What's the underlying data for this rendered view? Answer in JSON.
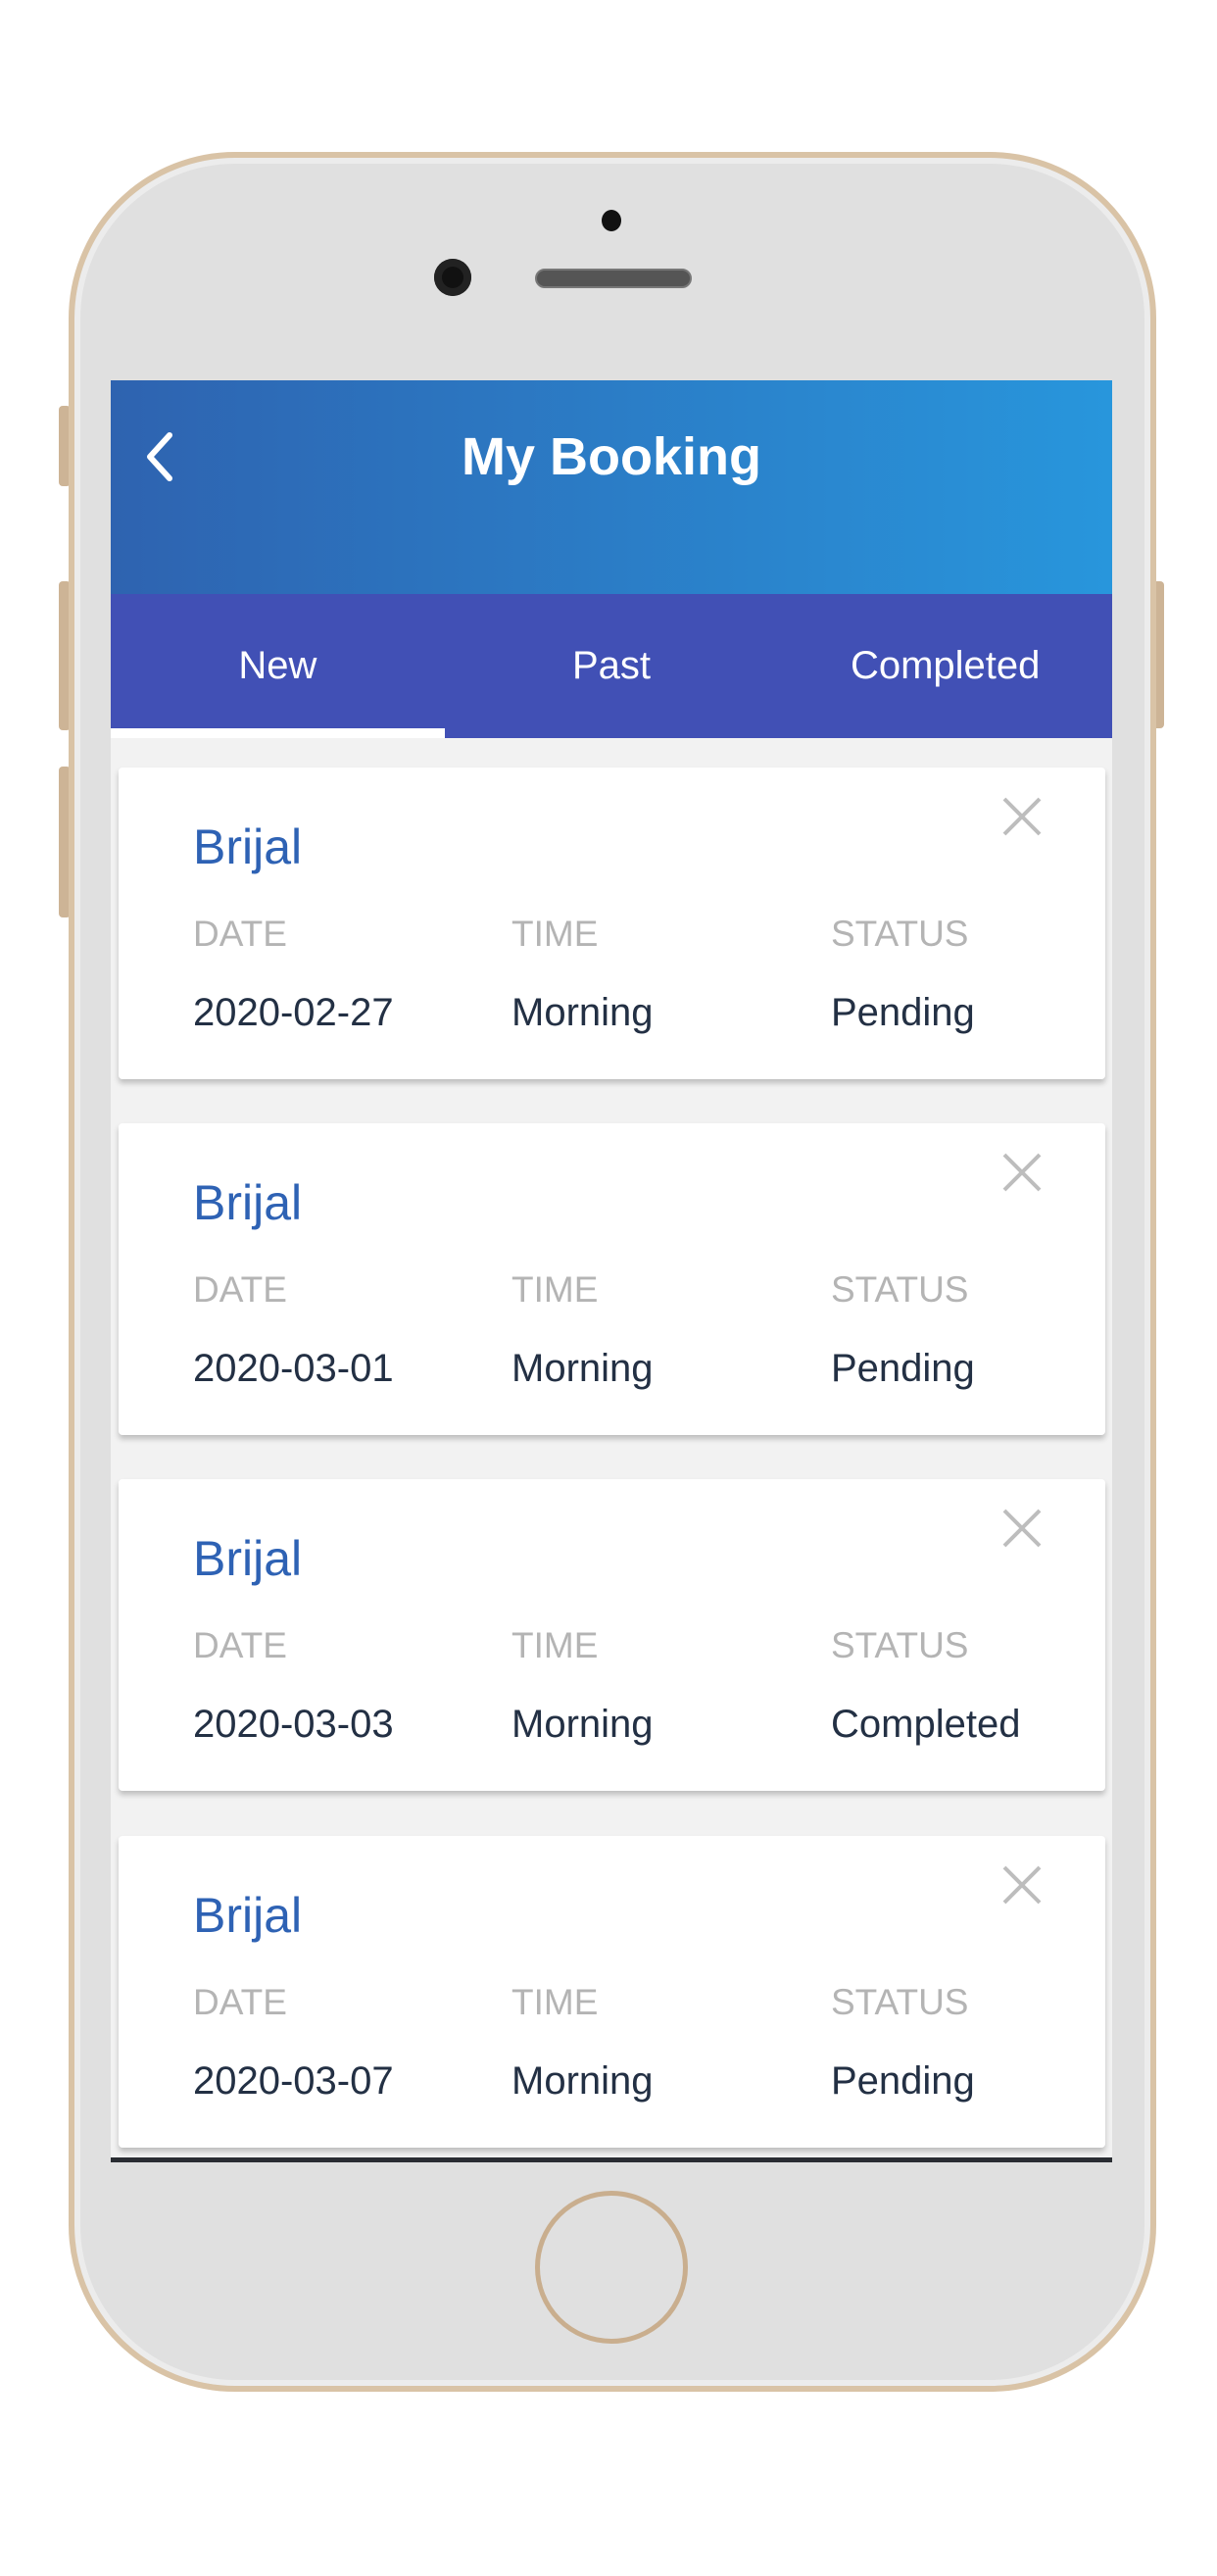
{
  "header": {
    "title": "My Booking",
    "back_icon": "chevron-left-icon"
  },
  "tabs": [
    {
      "label": "New",
      "active": true
    },
    {
      "label": "Past",
      "active": false
    },
    {
      "label": "Completed",
      "active": false
    }
  ],
  "colors": {
    "header_start": "#2e63b0",
    "header_end": "#2896dc",
    "tabs_bg": "#4150b5",
    "name": "#2e62b4"
  },
  "labels": {
    "date": "DATE",
    "time": "TIME",
    "status": "STATUS"
  },
  "bookings": [
    {
      "name": "Brijal",
      "date": "2020-02-27",
      "time": "Morning",
      "status": "Pending"
    },
    {
      "name": "Brijal",
      "date": "2020-03-01",
      "time": "Morning",
      "status": "Pending"
    },
    {
      "name": "Brijal",
      "date": "2020-03-03",
      "time": "Morning",
      "status": "Completed"
    },
    {
      "name": "Brijal",
      "date": "2020-03-07",
      "time": "Morning",
      "status": "Pending"
    }
  ]
}
